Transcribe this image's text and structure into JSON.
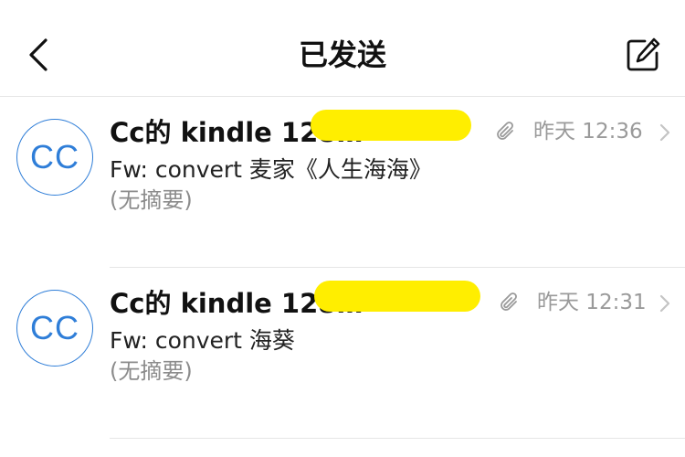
{
  "header": {
    "title": "已发送",
    "back_icon": "chevron-left-icon",
    "compose_icon": "compose-icon"
  },
  "mails": [
    {
      "avatar_initials": "CC",
      "sender": "Cc的 kindle 128…",
      "time": "昨天 12:36",
      "subject": "Fw: convert 麦家《人生海海》",
      "summary": "(无摘要)",
      "has_attachment": true
    },
    {
      "avatar_initials": "CC",
      "sender": "Cc的 kindle 128…",
      "time": "昨天 12:31",
      "subject": "Fw: convert 海葵",
      "summary": "(无摘要)",
      "has_attachment": true
    }
  ],
  "colors": {
    "accent": "#2f7ed8",
    "redaction": "#ffee00",
    "muted_text": "#9a9a9a"
  }
}
